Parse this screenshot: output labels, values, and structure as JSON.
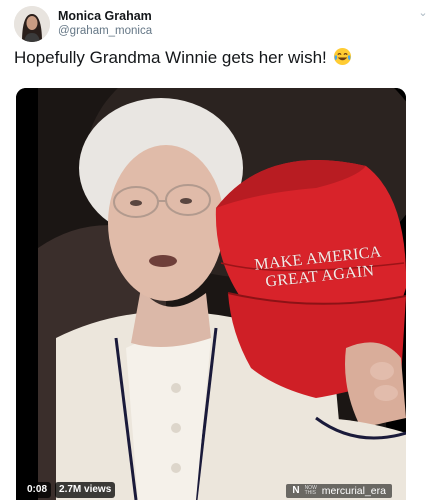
{
  "tweet": {
    "author_name": "Monica Graham",
    "author_handle": "@graham_monica",
    "text": "Hopefully Grandma Winnie gets her wish!",
    "emoji_icon": "face-with-tears-of-joy-icon"
  },
  "video": {
    "hat_text_line1": "MAKE AMERICA",
    "hat_text_line2": "GREAT AGAIN",
    "timestamp": "0:08",
    "views": "2.7M views",
    "watermark_logo": "N",
    "watermark_mini_line1": "NOW",
    "watermark_mini_line2": "THIS",
    "watermark_name": "mercurial_era"
  },
  "colors": {
    "hat_red": "#d8232a",
    "text_primary": "#14171a",
    "text_secondary": "#657786"
  }
}
